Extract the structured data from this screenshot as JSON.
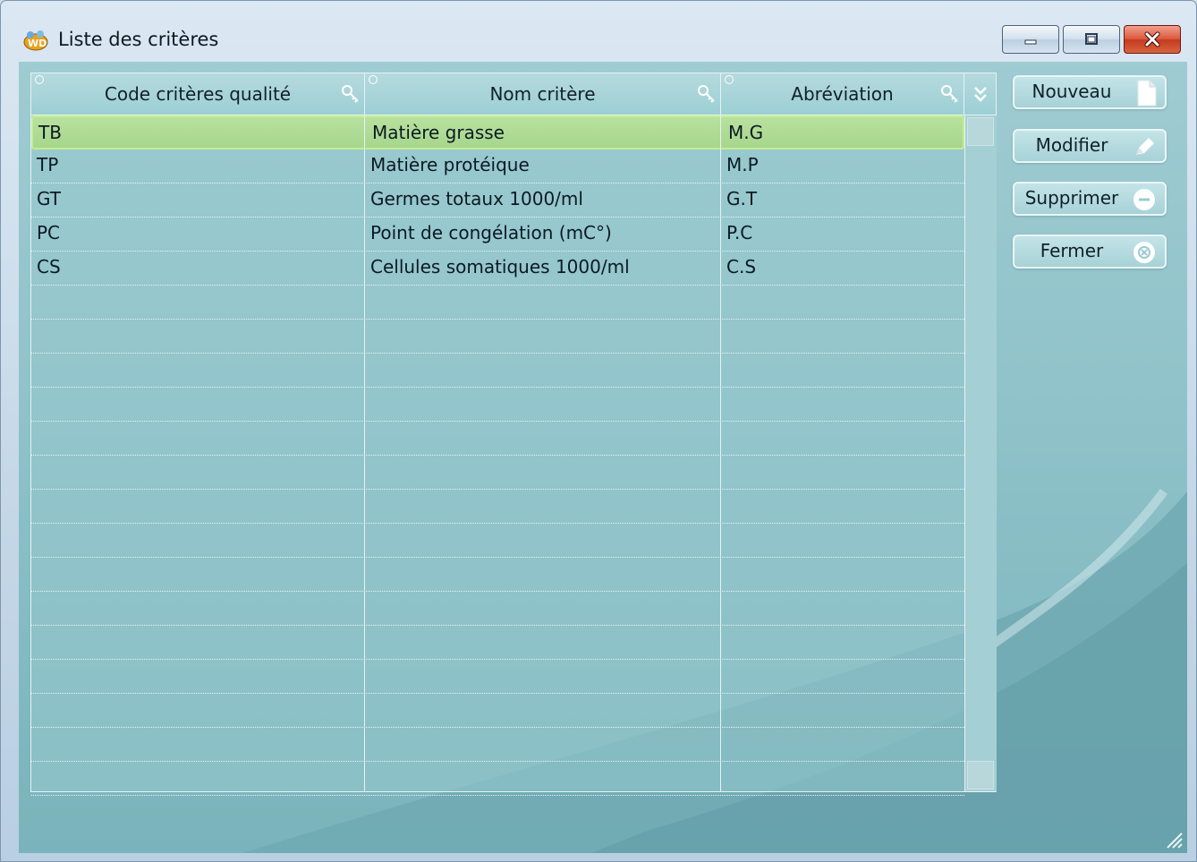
{
  "window": {
    "title": "Liste des critères",
    "icon": "windev-app-icon",
    "controls": [
      "minimize-icon",
      "maximize-icon",
      "close-icon"
    ]
  },
  "table": {
    "columns": [
      {
        "label": "Code critères qualité",
        "icon": "key-icon"
      },
      {
        "label": "Nom critère",
        "icon": "key-icon"
      },
      {
        "label": "Abréviation",
        "icon": "key-icon"
      }
    ],
    "rows": [
      {
        "code": "TB",
        "nom": "Matière grasse",
        "abrev": "M.G",
        "selected": true
      },
      {
        "code": "TP",
        "nom": "Matière protéique",
        "abrev": "M.P",
        "selected": false
      },
      {
        "code": "GT",
        "nom": "Germes totaux 1000/ml",
        "abrev": "G.T",
        "selected": false
      },
      {
        "code": "PC",
        "nom": "Point de congélation (mC°)",
        "abrev": "P.C",
        "selected": false
      },
      {
        "code": "CS",
        "nom": "Cellules somatiques 1000/ml",
        "abrev": "C.S",
        "selected": false
      }
    ]
  },
  "buttons": {
    "nouveau": "Nouveau",
    "modifier": "Modifier",
    "supprimer": "Supprimer",
    "fermer": "Fermer"
  },
  "colors": {
    "client_bg": "#8fc2c9",
    "selection": "#b8e19f",
    "close_button": "#c63a1f"
  }
}
